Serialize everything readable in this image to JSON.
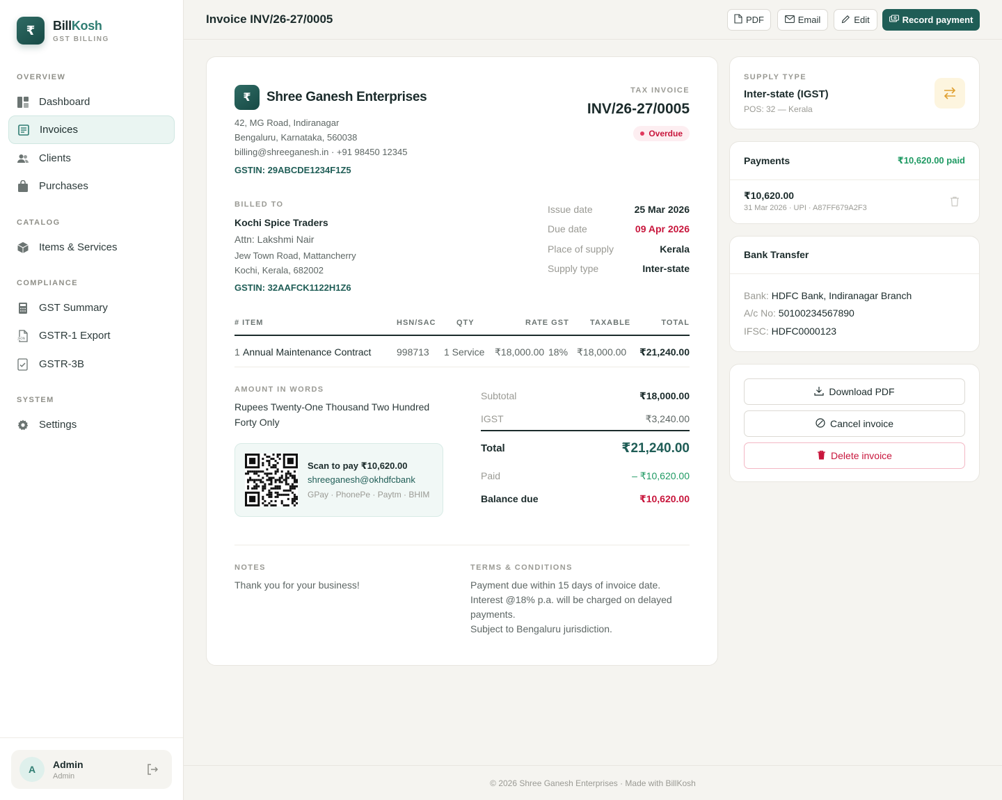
{
  "brand": {
    "logo_glyph": "₹",
    "name_part1": "Bill",
    "name_part2": "Kosh",
    "subtitle": "GST BILLING",
    "accent_color": "#2f7d72"
  },
  "sidebar": {
    "sections": [
      {
        "label": "OVERVIEW"
      },
      {
        "label": "CATALOG"
      },
      {
        "label": "COMPLIANCE"
      },
      {
        "label": "SYSTEM"
      }
    ],
    "items": [
      {
        "label": "Dashboard",
        "icon": "dashboard-icon"
      },
      {
        "label": "Invoices",
        "icon": "invoice-icon",
        "active": true
      },
      {
        "label": "Clients",
        "icon": "users-icon"
      },
      {
        "label": "Purchases",
        "icon": "bag-icon"
      },
      {
        "label": "Items & Services",
        "icon": "box-icon"
      },
      {
        "label": "GST Summary",
        "icon": "calculator-icon"
      },
      {
        "label": "GSTR-1 Export",
        "icon": "json-file-icon"
      },
      {
        "label": "GSTR-3B",
        "icon": "checklist-icon"
      },
      {
        "label": "Settings",
        "icon": "gear-icon"
      }
    ],
    "user": {
      "initial": "A",
      "name": "Admin",
      "role": "Admin"
    }
  },
  "topbar": {
    "title": "Invoice INV/26-27/0005",
    "buttons": {
      "pdf": "PDF",
      "email": "Email",
      "edit": "Edit",
      "record_payment": "Record payment"
    }
  },
  "invoice": {
    "seller": {
      "logo_glyph": "₹",
      "name": "Shree Ganesh Enterprises",
      "address_lines": [
        "42, MG Road, Indiranagar",
        "Bengaluru, Karnataka, 560038",
        "billing@shreeganesh.in · +91 98450 12345"
      ],
      "gstin": "GSTIN: 29ABCDE1234F1Z5"
    },
    "doc_label": "TAX INVOICE",
    "number": "INV/26-27/0005",
    "status": "Overdue",
    "billed_to": {
      "label": "BILLED TO",
      "name": "Kochi Spice Traders",
      "attn": "Attn: Lakshmi Nair",
      "address_lines": [
        "Jew Town Road, Mattancherry",
        "Kochi, Kerala, 682002"
      ],
      "gstin": "GSTIN: 32AAFCK1122H1Z6"
    },
    "meta": [
      {
        "label": "Issue date",
        "value": "25 Mar 2026"
      },
      {
        "label": "Due date",
        "value": "09 Apr 2026"
      },
      {
        "label": "Place of supply",
        "value": "Kerala"
      },
      {
        "label": "Supply type",
        "value": "Inter-state"
      }
    ],
    "table": {
      "headers": {
        "item": "# ITEM",
        "hsn": "HSN/SAC",
        "qty": "QTY",
        "rate_gst": "RATE GST",
        "taxable": "TAXABLE",
        "total": "TOTAL"
      },
      "rows": [
        {
          "num": "1",
          "item": "Annual Maintenance Contract",
          "hsn": "998713",
          "qty": "1 Service",
          "rate": "₹18,000.00",
          "gst": "18%",
          "taxable": "₹18,000.00",
          "total": "₹21,240.00"
        }
      ]
    },
    "amount_in_words_label": "AMOUNT IN WORDS",
    "amount_in_words": "Rupees Twenty-One Thousand Two Hundred Forty Only",
    "upi": {
      "title": "Scan to pay ₹10,620.00",
      "id": "shreeganesh@okhdfcbank",
      "apps": "GPay · PhonePe · Paytm · BHIM"
    },
    "totals": {
      "subtotal_label": "Subtotal",
      "subtotal": "₹18,000.00",
      "igst_label": "IGST",
      "igst": "₹3,240.00",
      "total_label": "Total",
      "total": "₹21,240.00",
      "paid_label": "Paid",
      "paid": "– ₹10,620.00",
      "balance_label": "Balance due",
      "balance": "₹10,620.00"
    },
    "notes_label": "NOTES",
    "notes": "Thank you for your business!",
    "terms_label": "TERMS & CONDITIONS",
    "terms_lines": [
      "Payment due within 15 days of invoice date.",
      "Interest @18% p.a. will be charged on delayed payments.",
      "Subject to Bengaluru jurisdiction."
    ]
  },
  "supply_card": {
    "label": "SUPPLY TYPE",
    "value": "Inter-state (IGST)",
    "pos": "POS: 32 — Kerala",
    "icon": "swap-arrows-icon"
  },
  "payments_card": {
    "title": "Payments",
    "paid_summary": "₹10,620.00 paid",
    "entries": [
      {
        "amount": "₹10,620.00",
        "details": "31 Mar 2026 · UPI · A87FF679A2F3"
      }
    ]
  },
  "bank_card": {
    "title": "Bank Transfer",
    "bank_label": "Bank:",
    "bank": "HDFC Bank, Indiranagar Branch",
    "acct_label": "A/c No:",
    "acct": "50100234567890",
    "ifsc_label": "IFSC:",
    "ifsc": "HDFC0000123"
  },
  "actions": {
    "download": "Download PDF",
    "cancel": "Cancel invoice",
    "delete": "Delete invoice"
  },
  "footer": "© 2026 Shree Ganesh Enterprises · Made with BillKosh",
  "colors": {
    "primary": "#1f5d56",
    "danger": "#c8163c",
    "success": "#1f9a63",
    "warning": "#e0a030"
  }
}
